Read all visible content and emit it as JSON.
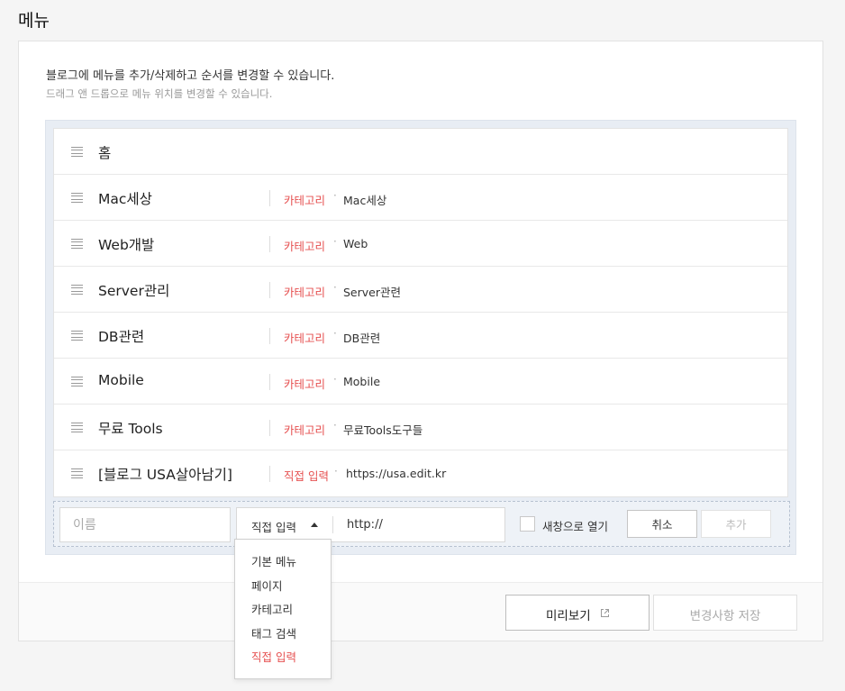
{
  "page": {
    "title": "메뉴"
  },
  "description": {
    "line1": "블로그에 메뉴를 추가/삭제하고 순서를 변경할 수 있습니다.",
    "line2": "드래그 앤 드롭으로 메뉴 위치를 변경할 수 있습니다."
  },
  "menu_items": [
    {
      "name": "홈",
      "type": "",
      "target": ""
    },
    {
      "name": "Mac세상",
      "type": "카테고리",
      "target": "Mac세상"
    },
    {
      "name": "Web개발",
      "type": "카테고리",
      "target": "Web"
    },
    {
      "name": "Server관리",
      "type": "카테고리",
      "target": "Server관련"
    },
    {
      "name": "DB관련",
      "type": "카테고리",
      "target": "DB관련"
    },
    {
      "name": "Mobile",
      "type": "카테고리",
      "target": "Mobile"
    },
    {
      "name": "무료 Tools",
      "type": "카테고리",
      "target": "무료Tools도구들"
    },
    {
      "name": "[블로그 USA살아남기]",
      "type": "직접 입력",
      "target": "https://usa.edit.kr"
    }
  ],
  "add_form": {
    "name_placeholder": "이름",
    "type_selected": "직접 입력",
    "url_value": "http://",
    "new_window_label": "새창으로 열기",
    "new_window_checked": false,
    "cancel_label": "취소",
    "add_label": "추가"
  },
  "type_dropdown": {
    "options": [
      "기본 메뉴",
      "페이지",
      "카테고리",
      "태그 검색",
      "직접 입력"
    ],
    "selected_index": 4
  },
  "footer": {
    "preview_label": "미리보기",
    "save_label": "변경사항 저장"
  },
  "colors": {
    "accent": "#e65050",
    "board_bg": "#e8edf4"
  },
  "icons": {
    "drag_handle": "drag-handle-icon",
    "caret": "caret-up-icon",
    "external": "external-link-icon"
  }
}
